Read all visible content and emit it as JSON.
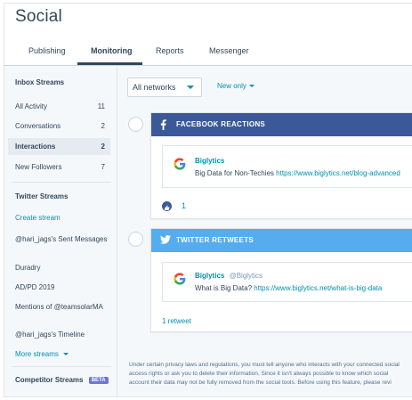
{
  "app": {
    "title": "Social"
  },
  "tabs": [
    {
      "label": "Publishing"
    },
    {
      "label": "Monitoring",
      "active": true
    },
    {
      "label": "Reports"
    },
    {
      "label": "Messenger"
    }
  ],
  "sidebar": {
    "inbox_heading": "Inbox Streams",
    "inbox_items": [
      {
        "label": "All Activity",
        "count": "11"
      },
      {
        "label": "Conversations",
        "count": "2"
      },
      {
        "label": "Interactions",
        "count": "2",
        "active": true
      },
      {
        "label": "New Followers",
        "count": "7"
      }
    ],
    "twitter_heading": "Twitter Streams",
    "create_stream": "Create stream",
    "twitter_items": [
      {
        "label": "@hari_jags's Sent Messages"
      },
      {
        "label": "Duradry"
      },
      {
        "label": "AD/PD 2019"
      },
      {
        "label": "Mentions of @teamsolarMA"
      },
      {
        "label": "@hari_jags's Timeline"
      }
    ],
    "more_streams": "More streams",
    "competitor_heading": "Competitor Streams",
    "beta_badge": "BETA"
  },
  "filters": {
    "network_select": "All networks",
    "new_only": "New only"
  },
  "cards": [
    {
      "network": "facebook",
      "header": "FACEBOOK REACTIONS",
      "author": "Biglytics",
      "text": "Big Data for Non-Techies",
      "link": "https://www.biglytics.net/blog-advanced",
      "reaction_count": "1"
    },
    {
      "network": "twitter",
      "header": "TWITTER RETWEETS",
      "author": "Biglytics",
      "handle": "@Biglytics",
      "text": "What is Big Data?",
      "link": "https://www.biglytics.net/what-is-big-data",
      "retweet_label": "1 retweet"
    }
  ],
  "disclaimer": {
    "line1": "Under certain privacy laws and regulations, you must tell anyone who interacts with your connected social",
    "line2": "access rights or ask you to delete their information. Since it isn't always possible to know which social",
    "line3": "account their data may not be fully removed from the social tools. Before using this feature, please revi"
  },
  "colors": {
    "facebook": "#3b5998",
    "twitter": "#55acee",
    "link": "#0091ae",
    "text": "#33475b",
    "beta": "#6a78d1"
  },
  "icons": {
    "facebook": "facebook-icon",
    "twitter": "twitter-icon",
    "like": "thumbs-up-icon",
    "caret": "caret-down-icon",
    "brand": "google-g-logo"
  }
}
